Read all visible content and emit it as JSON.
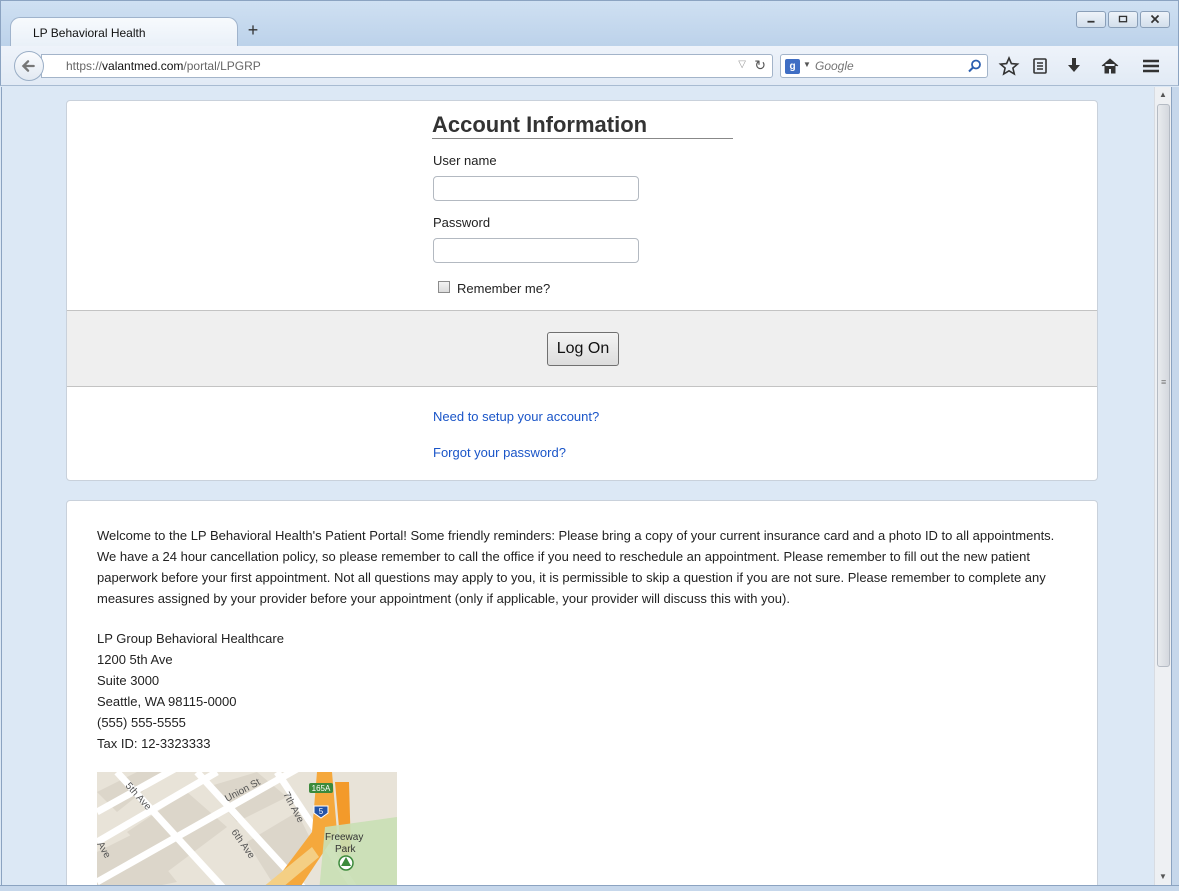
{
  "browser": {
    "tab_title": "LP Behavioral Health",
    "new_tab_glyph": "+",
    "url_protocol": "https://",
    "url_domain": "valantmed.com",
    "url_path": "/portal/LPGRP",
    "search_placeholder": "Google",
    "search_engine_glyph": "g"
  },
  "login": {
    "title": "Account Information",
    "username_label": "User name",
    "username_value": "",
    "password_label": "Password",
    "password_value": "",
    "remember_label": "Remember me?",
    "remember_checked": false,
    "logon_button": "Log On",
    "setup_link": "Need to setup your account?",
    "forgot_link": "Forgot your password?"
  },
  "info": {
    "welcome_text": "Welcome to the LP Behavioral Health's Patient Portal! Some friendly reminders: Please bring a copy of your current insurance card and a photo ID to all appointments. We have a 24 hour cancellation policy, so please remember to call the office if you need to reschedule an appointment. Please remember to fill out the new patient paperwork before your first appointment. Not all questions may apply to you, it is permissible to skip a question if you are not sure. Please remember to complete any measures assigned by your provider before your appointment (only if applicable, your provider will discuss this with you).",
    "org_name": "LP Group Behavioral Healthcare",
    "address_line1": "1200 5th Ave",
    "address_line2": "Suite 3000",
    "city_state_zip": "Seattle, WA 98115-0000",
    "phone": "(555) 555-5555",
    "tax_id": "Tax ID: 12-3323333"
  },
  "map": {
    "street_5th": "5th Ave",
    "street_union": "Union St",
    "street_7th": "7th Ave",
    "street_6th": "6th Ave",
    "street_ave": "Ave",
    "exit_label": "165A",
    "interstate": "5",
    "park_name_1": "Freeway",
    "park_name_2": "Park"
  },
  "colors": {
    "link": "#1a55c8",
    "page_bg": "#dce8f5",
    "action_bar": "#efefef"
  }
}
